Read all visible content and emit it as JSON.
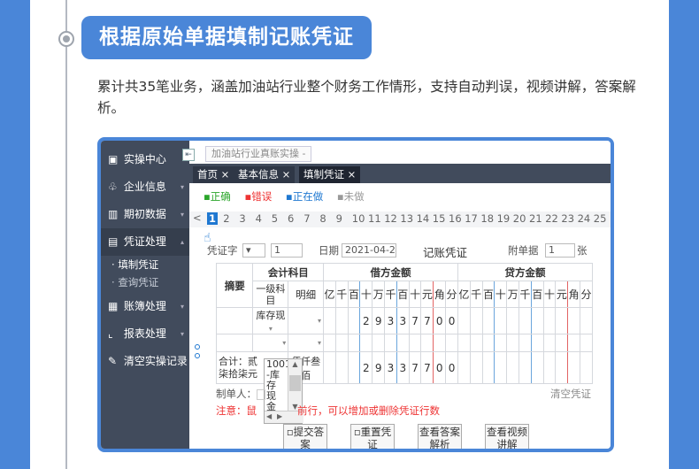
{
  "header": {
    "title": "根据原始单据填制记账凭证",
    "description": "累计共35笔业务，涵盖加油站行业整个财务工作情形，支持自动判误，视频讲解，答案解析。"
  },
  "sidebar": {
    "items": [
      {
        "label": "实操中心",
        "icon": "desktop-icon"
      },
      {
        "label": "企业信息",
        "icon": "org-icon"
      },
      {
        "label": "期初数据",
        "icon": "bar-chart-icon"
      },
      {
        "label": "凭证处理",
        "icon": "document-icon"
      },
      {
        "label": "账簿处理",
        "icon": "book-icon"
      },
      {
        "label": "报表处理",
        "icon": "line-chart-icon"
      },
      {
        "label": "清空实操记录",
        "icon": "eraser-icon"
      }
    ],
    "sub_items": [
      "填制凭证",
      "查询凭证"
    ]
  },
  "breadcrumb": "加油站行业真账实操 -",
  "tabs": [
    "首页 ×",
    "基本信息 ×",
    "填制凭证 ×"
  ],
  "legend": {
    "correct": "正确",
    "wrong": "错误",
    "doing": "正在做",
    "undone": "未做"
  },
  "pager": {
    "prev": "<",
    "pages": [
      "1",
      "2",
      "3",
      "4",
      "5",
      "6",
      "7",
      "8",
      "9",
      "10",
      "11",
      "12",
      "13",
      "14",
      "15",
      "16",
      "17",
      "18",
      "19",
      "20",
      "21",
      "22",
      "23",
      "24",
      "25"
    ]
  },
  "voucher": {
    "type_label": "凭证字",
    "number_value": "1",
    "date_label": "日期",
    "date_value": "2021-04-2",
    "title": "记账凭证",
    "attach_label": "附单据",
    "attach_value": "1",
    "attach_unit": "张"
  },
  "table": {
    "summary": "摘要",
    "account": "会计科目",
    "level1": "一级科目",
    "detail": "明细",
    "debit": "借方金额",
    "credit": "贷方金额",
    "units": [
      "亿",
      "千",
      "百",
      "十",
      "万",
      "千",
      "百",
      "十",
      "元",
      "角",
      "分"
    ],
    "row1_account": "库存现",
    "row1_digits": [
      "",
      "",
      "",
      "2",
      "9",
      "3",
      "3",
      "7",
      "7",
      "0",
      "0"
    ],
    "total_label": "合计：贰",
    "total_label2": "柒拾柒元",
    "total_mid": "佰仟叁佰",
    "total_digits": [
      "",
      "",
      "",
      "2",
      "9",
      "3",
      "3",
      "7",
      "7",
      "0",
      "0"
    ]
  },
  "dropdown_options": [
    "1001",
    "-库",
    "存",
    "现",
    "金"
  ],
  "maker_label": "制单人：",
  "clear_label": "清空凭证",
  "notice_prefix": "注意：鼠",
  "notice_suffix": "前行，可以增加或删除凭证行数",
  "buttons": [
    {
      "l1": "提交答",
      "l2": "案"
    },
    {
      "l1": "重置凭",
      "l2": "证"
    },
    {
      "l1": "查看答案",
      "l2": "解析"
    },
    {
      "l1": "查看视频",
      "l2": "讲解"
    }
  ],
  "colors": {
    "brand_blue": "#4a86d8",
    "sidebar": "#414b5c",
    "correct": "#2aa52a",
    "wrong": "#e33",
    "doing": "#1f78d1",
    "undone": "#999"
  }
}
